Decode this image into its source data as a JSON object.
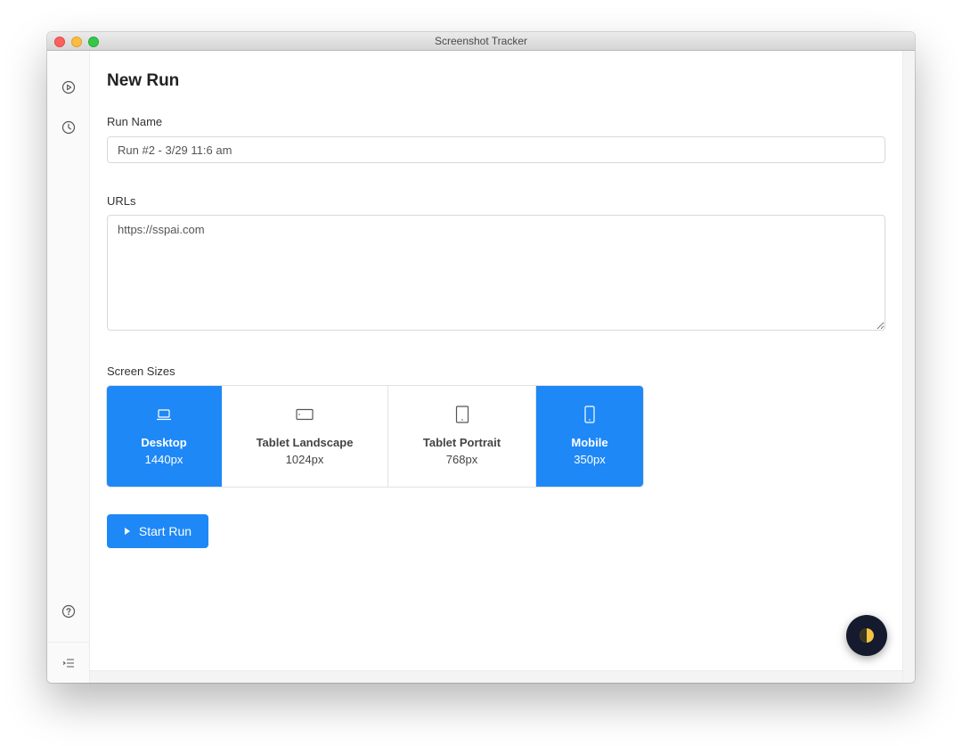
{
  "window": {
    "title": "Screenshot Tracker"
  },
  "sidebar": {
    "top_icons": [
      "play-circle-icon",
      "clock-icon"
    ],
    "bottom_icons": [
      "help-circle-icon",
      "indent-list-icon"
    ]
  },
  "main": {
    "title": "New Run",
    "run_name_label": "Run Name",
    "run_name_value": "Run #2 - 3/29 11:6 am",
    "urls_label": "URLs",
    "urls_value": "https://sspai.com",
    "screen_sizes_label": "Screen Sizes",
    "screen_sizes": [
      {
        "name": "Desktop",
        "size": "1440px",
        "selected": true,
        "icon": "laptop-icon"
      },
      {
        "name": "Tablet Landscape",
        "size": "1024px",
        "selected": false,
        "icon": "tablet-landscape-icon"
      },
      {
        "name": "Tablet Portrait",
        "size": "768px",
        "selected": false,
        "icon": "tablet-portrait-icon"
      },
      {
        "name": "Mobile",
        "size": "350px",
        "selected": true,
        "icon": "mobile-icon"
      }
    ],
    "start_button_label": "Start Run"
  },
  "theme_toggle_icon": "half-moon-icon",
  "colors": {
    "accent": "#1e88f7",
    "fab_bg": "#151a2e",
    "fab_icon": "#f5c242"
  }
}
